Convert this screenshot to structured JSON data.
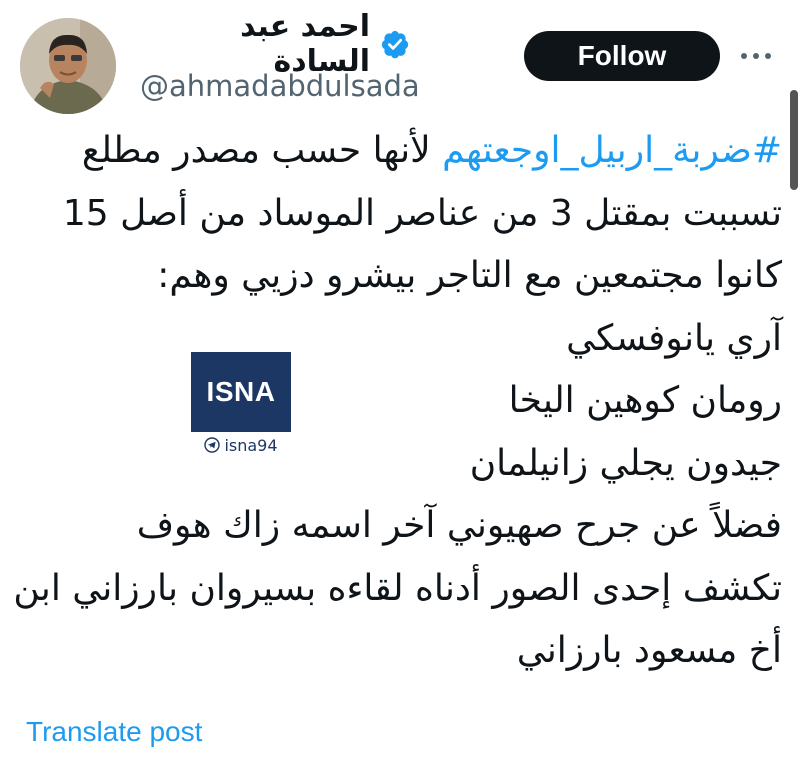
{
  "author": {
    "display_name": "احمد عبد السادة",
    "handle": "@ahmadabdulsada",
    "verified": true
  },
  "actions": {
    "follow_label": "Follow",
    "more_icon": "more-horizontal-icon"
  },
  "tweet": {
    "hashtag": "#ضربة_اربيل_اوجعتهم",
    "line1_rest": " لأنها حسب مصدر مطلع",
    "lines": [
      "تسببت بمقتل 3 من عناصر الموساد من أصل 15",
      "كانوا مجتمعين مع التاجر بيشرو دزيي وهم:",
      "آري يانوفسكي",
      "رومان كوهين اليخا",
      "جيدون يجلي زانيلمان",
      "فضلاً عن جرح صهيوني آخر اسمه زاك هوف",
      "تكشف إحدى الصور أدناه لقاءه بسيروان بارزاني ابن",
      "أخ مسعود بارزاني"
    ]
  },
  "watermark": {
    "logo_text": "ISNA",
    "channel": "isna94",
    "icon": "telegram-icon"
  },
  "translate_label": "Translate post",
  "colors": {
    "link": "#1d9bf0",
    "text": "#0f1419",
    "secondary": "#536471",
    "follow_bg": "#0f1419",
    "isna_bg": "#1c3764"
  }
}
